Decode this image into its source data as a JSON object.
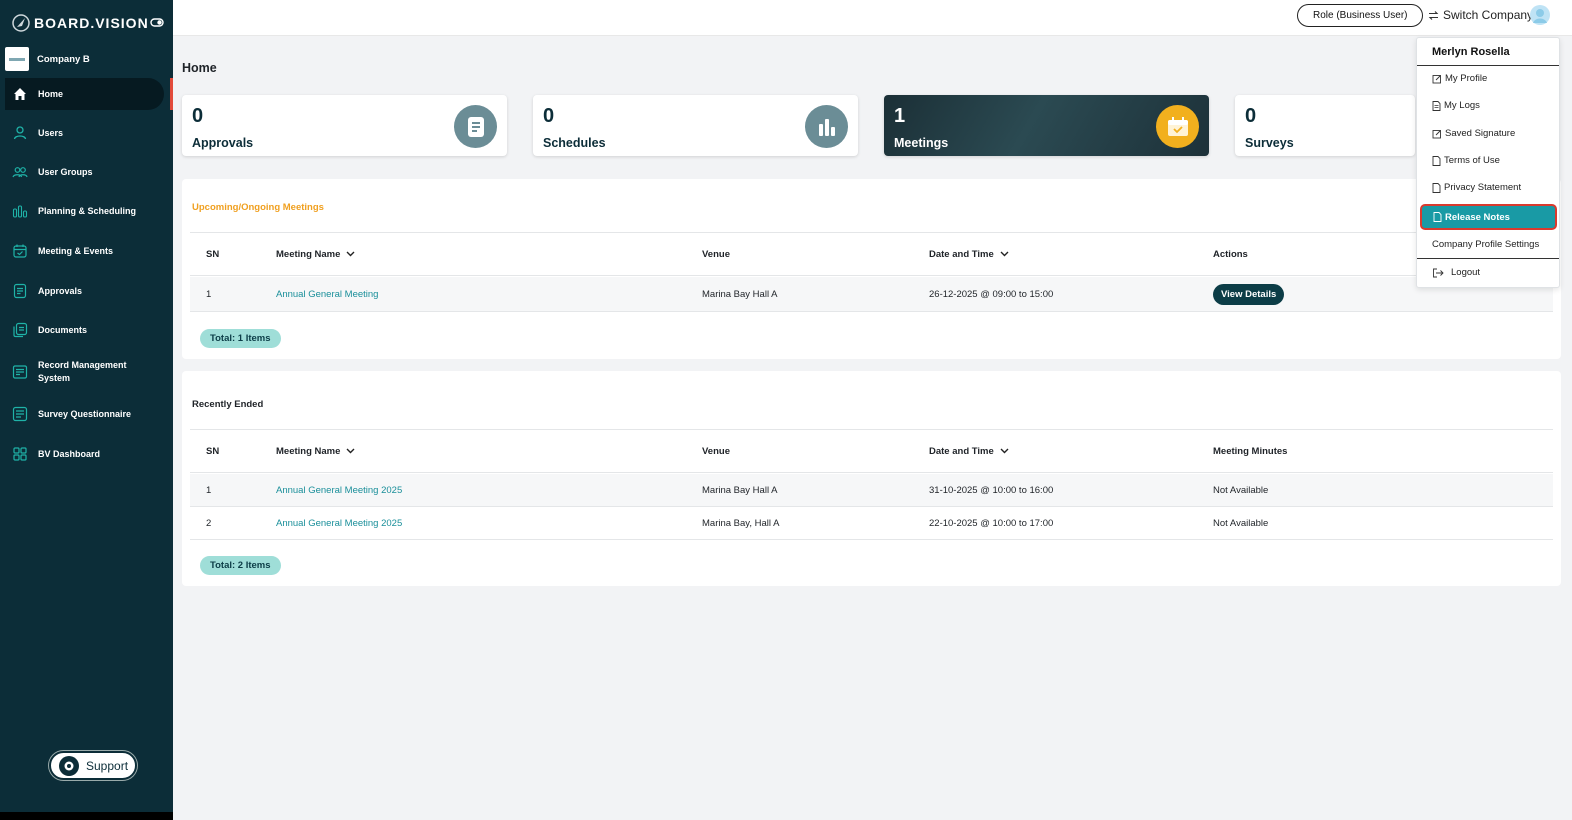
{
  "app": {
    "logo_text": "BOARD.VISION",
    "company_name": "Company B"
  },
  "sidebar": {
    "items": [
      {
        "label": "Home",
        "icon": "home-icon"
      },
      {
        "label": "Users",
        "icon": "user-icon"
      },
      {
        "label": "User Groups",
        "icon": "user-group-icon"
      },
      {
        "label": "Planning & Scheduling",
        "icon": "chart-bars-icon"
      },
      {
        "label": "Meeting & Events",
        "icon": "calendar-icon"
      },
      {
        "label": "Approvals",
        "icon": "approval-icon"
      },
      {
        "label": "Documents",
        "icon": "documents-icon"
      },
      {
        "label": "Record Management System",
        "icon": "records-icon"
      },
      {
        "label": "Survey Questionnaire",
        "icon": "survey-icon"
      },
      {
        "label": "BV Dashboard",
        "icon": "dashboard-icon"
      }
    ],
    "support_label": "Support"
  },
  "topbar": {
    "role_label": "Role (Business User)",
    "switch_label": "Switch Company"
  },
  "page": {
    "title": "Home"
  },
  "cards": [
    {
      "count": "0",
      "label": "Approvals",
      "icon": "document-icon"
    },
    {
      "count": "0",
      "label": "Schedules",
      "icon": "bar-chart-icon"
    },
    {
      "count": "1",
      "label": "Meetings",
      "icon": "calendar-icon"
    },
    {
      "count": "0",
      "label": "Surveys",
      "icon": "survey-icon"
    }
  ],
  "upcoming": {
    "title": "Upcoming/Ongoing Meetings",
    "columns": [
      "SN",
      "Meeting Name",
      "Venue",
      "Date and Time",
      "Actions"
    ],
    "rows": [
      {
        "sn": "1",
        "name": "Annual General Meeting",
        "venue": "Marina Bay Hall A",
        "datetime": "26-12-2025 @ 09:00 to 15:00",
        "action": "View Details"
      }
    ],
    "total": "Total: 1 Items"
  },
  "ended": {
    "title": "Recently Ended",
    "columns": [
      "SN",
      "Meeting Name",
      "Venue",
      "Date and Time",
      "Meeting Minutes"
    ],
    "rows": [
      {
        "sn": "1",
        "name": "Annual General Meeting 2025",
        "venue": "Marina Bay Hall A",
        "datetime": "31-10-2025 @ 10:00 to 16:00",
        "minutes": "Not Available"
      },
      {
        "sn": "2",
        "name": "Annual General Meeting 2025",
        "venue": "Marina Bay, Hall A",
        "datetime": "22-10-2025 @ 10:00 to 17:00",
        "minutes": "Not Available"
      }
    ],
    "total": "Total: 2 Items"
  },
  "user_menu": {
    "name": "Merlyn Rosella",
    "items": [
      "My Profile",
      "My Logs",
      "Saved Signature",
      "Terms of Use",
      "Privacy Statement",
      "Release Notes",
      "Company Profile Settings",
      "Logout"
    ],
    "highlighted": "Release Notes"
  },
  "colors": {
    "sidebar": "#0c2d38",
    "accent": "#199aa5",
    "warning": "#f0a020",
    "highlight_border": "#d93a2e"
  }
}
